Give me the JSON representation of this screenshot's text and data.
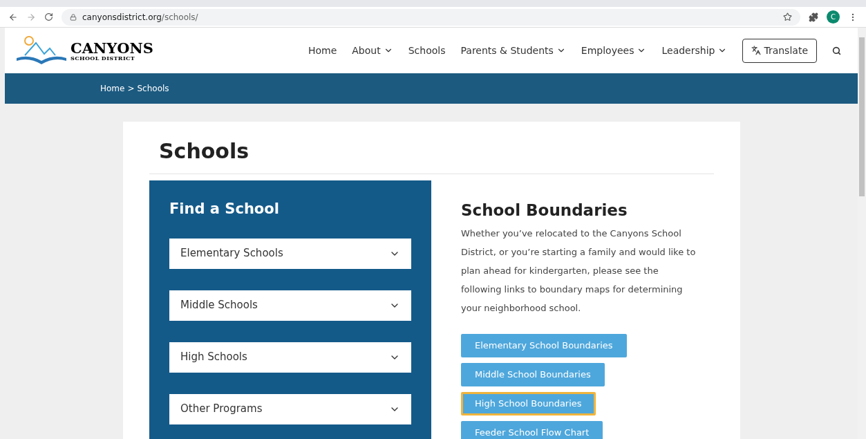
{
  "browser": {
    "url_host": "canyonsdistrict.org",
    "url_path": "/schools/",
    "profile_initial": "C"
  },
  "site": {
    "logo_title": "CANYONS",
    "logo_subtitle": "SCHOOL DISTRICT",
    "nav": [
      {
        "label": "Home",
        "has_menu": false
      },
      {
        "label": "About",
        "has_menu": true
      },
      {
        "label": "Schools",
        "has_menu": false
      },
      {
        "label": "Parents & Students",
        "has_menu": true
      },
      {
        "label": "Employees",
        "has_menu": true
      },
      {
        "label": "Leadership",
        "has_menu": true
      }
    ],
    "translate": "Translate"
  },
  "breadcrumb": [
    "Home",
    ">",
    "Schools"
  ],
  "page_title": "Schools",
  "find_panel": {
    "title": "Find a School",
    "dropdowns": [
      "Elementary Schools",
      "Middle Schools",
      "High Schools",
      "Other Programs"
    ]
  },
  "boundaries": {
    "title": "School Boundaries",
    "text": "Whether you’ve relocated to the Canyons School District, or you’re starting a family and would like to plan ahead for kindergarten, please see the following links to boundary maps for determining your neighborhood school.",
    "buttons": [
      {
        "label": "Elementary School Boundaries",
        "focused": false
      },
      {
        "label": "Middle School Boundaries",
        "focused": false
      },
      {
        "label": "High School Boundaries",
        "focused": true
      },
      {
        "label": "Feeder School Flow Chart",
        "focused": false
      }
    ]
  }
}
